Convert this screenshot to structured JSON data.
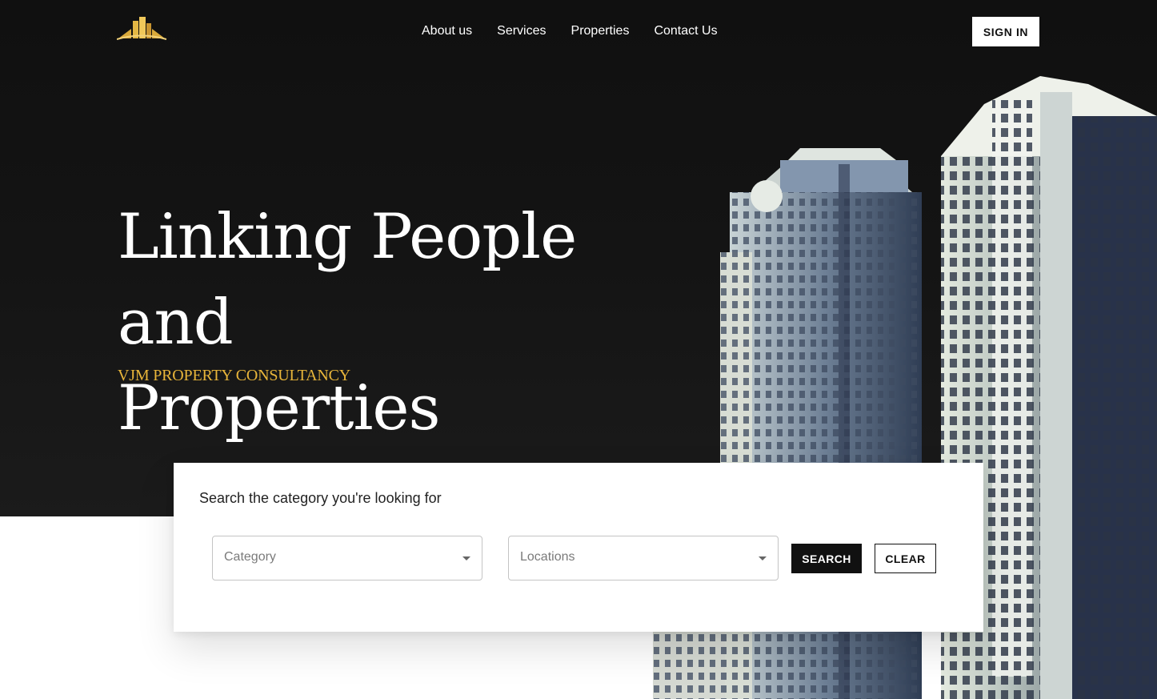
{
  "nav": {
    "items": [
      {
        "label": "About us"
      },
      {
        "label": "Services"
      },
      {
        "label": "Properties"
      },
      {
        "label": "Contact Us"
      }
    ],
    "signin_label": "SIGN IN"
  },
  "hero": {
    "headline_line1": "Linking People and",
    "headline_line2": "Properties",
    "tagline": "VJM PROPERTY CONSULTANCY"
  },
  "search": {
    "title": "Search the category you're looking for",
    "category_placeholder": "Category",
    "locations_placeholder": "Locations",
    "search_label": "SEARCH",
    "clear_label": "CLEAR"
  },
  "colors": {
    "hero_background": "#141414",
    "accent_gold": "#e8b53a",
    "button_dark": "#111111"
  }
}
